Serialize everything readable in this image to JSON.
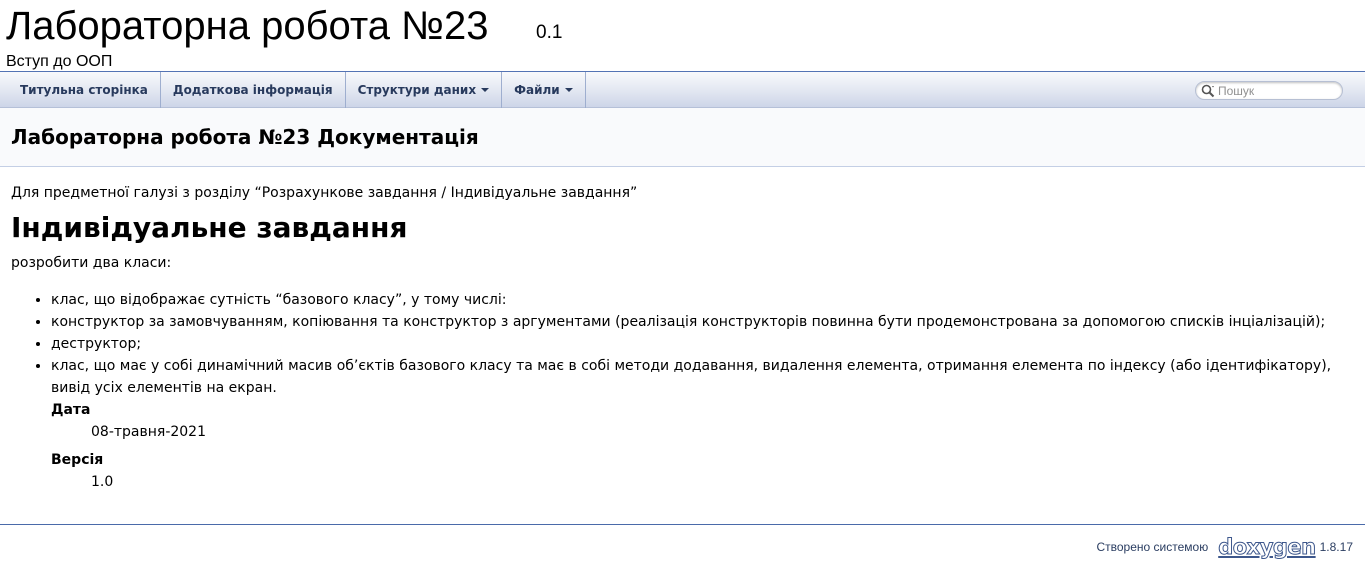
{
  "project": {
    "name": "Лабораторна робота №23",
    "number": "0.1",
    "brief": "Вступ до ООП"
  },
  "nav": {
    "items": [
      {
        "label": "Титульна сторінка",
        "dropdown": false
      },
      {
        "label": "Додаткова інформація",
        "dropdown": false
      },
      {
        "label": "Структури даних",
        "dropdown": true
      },
      {
        "label": "Файли",
        "dropdown": true
      }
    ],
    "search_placeholder": "Пошук",
    "search_icon": "magnifier-icon"
  },
  "header": {
    "title": "Лабораторна робота №23 Документація"
  },
  "content": {
    "intro": "Для предметної галузі з розділу “Розрахункове завдання / Індивідуальне завдання”",
    "heading": "Індивідуальне завдання",
    "lead": "розробити два класи:",
    "items": [
      "клас, що відображає сутність “базового класу”, у тому числі:",
      "конструктор за замовчуванням, копіювання та конструктор з аргументами (реалізація конструкторів повинна бути продемонстрована за допомогою списків інціалізацій);",
      "деструктор;",
      "клас, що має у собі динамічний масив об’єктів базового класу та має в собі методи додавання, видалення елемента, отримання елемента по індексу (або ідентифікатору), вивід усіх елементів на екран."
    ],
    "date_label": "Дата",
    "date_value": "08-травня-2021",
    "version_label": "Версія",
    "version_value": "1.0"
  },
  "footer": {
    "generated_by": "Створено системою",
    "logo_text": "doxygen",
    "version": "1.8.17"
  },
  "colors": {
    "nav_text": "#283a5d",
    "border": "#5373B4",
    "footer_text": "#2a3d61"
  }
}
